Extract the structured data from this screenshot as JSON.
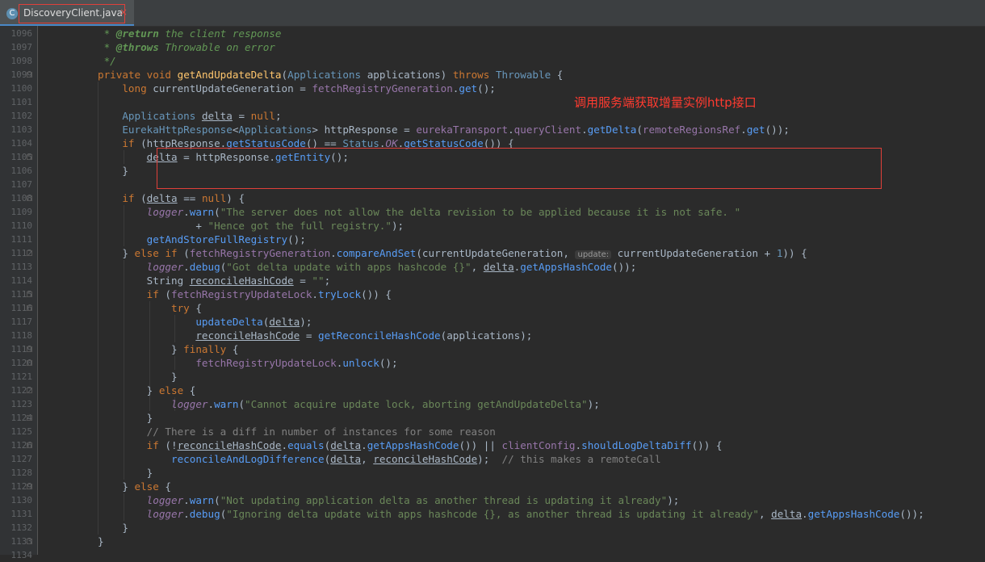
{
  "editor": {
    "tab": {
      "filename": "DiscoveryClient.java",
      "icon": "class-icon",
      "icon_glyph": "C",
      "close_glyph": "×",
      "close_color": "#c75450",
      "active_underline_color": "#4a88c7"
    },
    "theme": {
      "background": "#2b2b2b",
      "gutter_background": "#313335",
      "keyword": "#cc7832",
      "string": "#6a8759",
      "method_declaration": "#ffc66d",
      "field": "#9876aa",
      "comment": "#808080",
      "number": "#6897bb"
    },
    "annotation": {
      "text": "调用服务端获取增量实例http接口",
      "color": "#ff3b30"
    },
    "lines": [
      {
        "no": "1096",
        "text": " * @return the client response"
      },
      {
        "no": "1097",
        "text": " * @throws Throwable on error"
      },
      {
        "no": "1098",
        "text": " */"
      },
      {
        "no": "1099",
        "text": "private void getAndUpdateDelta(Applications applications) throws Throwable {"
      },
      {
        "no": "1100",
        "text": "    long currentUpdateGeneration = fetchRegistryGeneration.get();"
      },
      {
        "no": "1101",
        "text": ""
      },
      {
        "no": "1102",
        "text": "    Applications delta = null;"
      },
      {
        "no": "1103",
        "text": "    EurekaHttpResponse<Applications> httpResponse = eurekaTransport.queryClient.getDelta(remoteRegionsRef.get());"
      },
      {
        "no": "1104",
        "text": "    if (httpResponse.getStatusCode() == Status.OK.getStatusCode()) {"
      },
      {
        "no": "1105",
        "text": "        delta = httpResponse.getEntity();"
      },
      {
        "no": "1106",
        "text": "    }"
      },
      {
        "no": "1107",
        "text": ""
      },
      {
        "no": "1108",
        "text": "    if (delta == null) {"
      },
      {
        "no": "1109",
        "text": "        logger.warn(\"The server does not allow the delta revision to be applied because it is not safe. \""
      },
      {
        "no": "1110",
        "text": "                + \"Hence got the full registry.\");"
      },
      {
        "no": "1111",
        "text": "        getAndStoreFullRegistry();"
      },
      {
        "no": "1112",
        "text": "    } else if (fetchRegistryGeneration.compareAndSet(currentUpdateGeneration, update: currentUpdateGeneration + 1)) {"
      },
      {
        "no": "1113",
        "text": "        logger.debug(\"Got delta update with apps hashcode {}\", delta.getAppsHashCode());"
      },
      {
        "no": "1114",
        "text": "        String reconcileHashCode = \"\";"
      },
      {
        "no": "1115",
        "text": "        if (fetchRegistryUpdateLock.tryLock()) {"
      },
      {
        "no": "1116",
        "text": "            try {"
      },
      {
        "no": "1117",
        "text": "                updateDelta(delta);"
      },
      {
        "no": "1118",
        "text": "                reconcileHashCode = getReconcileHashCode(applications);"
      },
      {
        "no": "1119",
        "text": "            } finally {"
      },
      {
        "no": "1120",
        "text": "                fetchRegistryUpdateLock.unlock();"
      },
      {
        "no": "1121",
        "text": "            }"
      },
      {
        "no": "1122",
        "text": "        } else {"
      },
      {
        "no": "1123",
        "text": "            logger.warn(\"Cannot acquire update lock, aborting getAndUpdateDelta\");"
      },
      {
        "no": "1124",
        "text": "        }"
      },
      {
        "no": "1125",
        "text": "        // There is a diff in number of instances for some reason"
      },
      {
        "no": "1126",
        "text": "        if (!reconcileHashCode.equals(delta.getAppsHashCode()) || clientConfig.shouldLogDeltaDiff()) {"
      },
      {
        "no": "1127",
        "text": "            reconcileAndLogDifference(delta, reconcileHashCode);  // this makes a remoteCall"
      },
      {
        "no": "1128",
        "text": "        }"
      },
      {
        "no": "1129",
        "text": "    } else {"
      },
      {
        "no": "1130",
        "text": "        logger.warn(\"Not updating application delta as another thread is updating it already\");"
      },
      {
        "no": "1131",
        "text": "        logger.debug(\"Ignoring delta update with apps hashcode {}, as another thread is updating it already\", delta.getAppsHashCode());"
      },
      {
        "no": "1132",
        "text": "    }"
      },
      {
        "no": "1133",
        "text": "}"
      },
      {
        "no": "1134",
        "text": ""
      }
    ]
  }
}
